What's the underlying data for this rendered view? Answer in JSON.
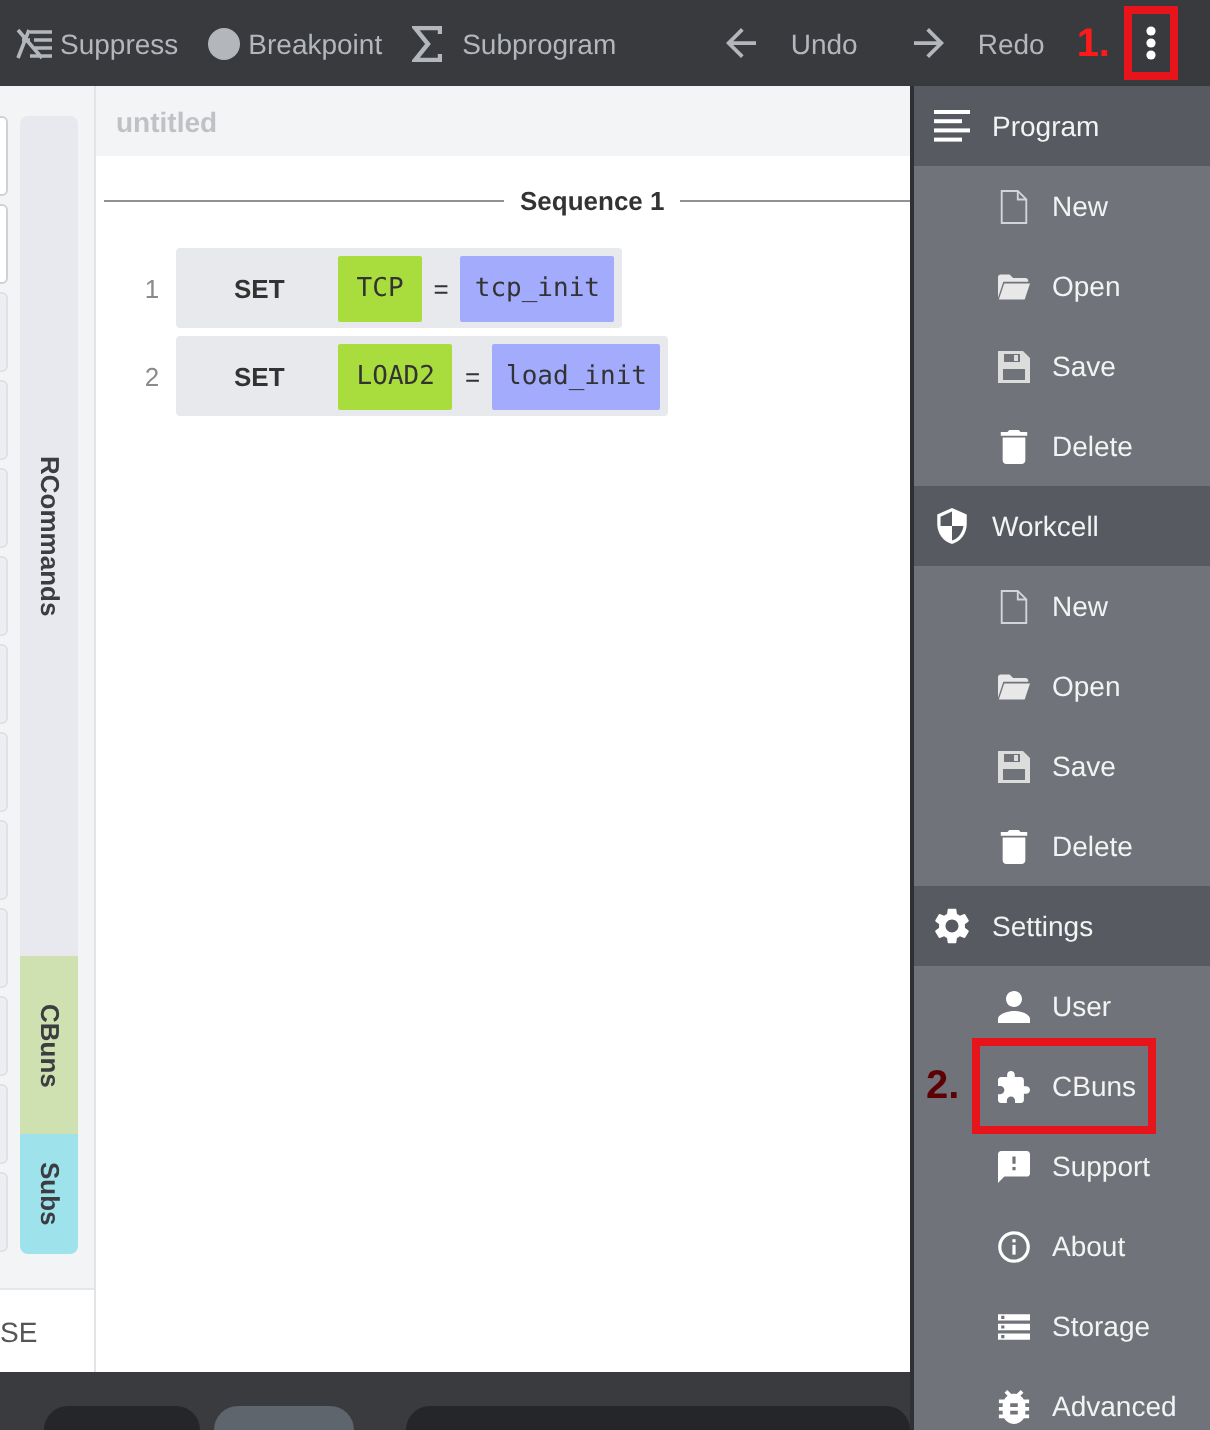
{
  "toolbar": {
    "tools": [
      {
        "kind": "suppress",
        "label": "Suppress"
      },
      {
        "kind": "breakpoint",
        "label": "Breakpoint"
      },
      {
        "kind": "subprogram",
        "label": "Subprogram"
      }
    ],
    "history": [
      {
        "kind": "undo",
        "label": "Undo"
      },
      {
        "kind": "redo",
        "label": "Redo"
      }
    ],
    "more_button": {
      "annotation": "1."
    }
  },
  "left_panel": {
    "side_tabs": [
      {
        "label": "RCommands",
        "color": "#e8e9ee"
      },
      {
        "label": "CBuns",
        "color": "#cfe0b1"
      },
      {
        "label": "Subs",
        "color": "#9ee3ec"
      }
    ],
    "footer_text": "SE"
  },
  "document": {
    "title": "untitled",
    "sequence_title": "Sequence 1",
    "lines": [
      {
        "number": "1",
        "command": "SET",
        "target": "TCP",
        "operator": "=",
        "value": "tcp_init"
      },
      {
        "number": "2",
        "command": "SET",
        "target": "LOAD2",
        "operator": "=",
        "value": "load_init"
      }
    ]
  },
  "menu": {
    "sections": [
      {
        "title": "Program",
        "kind": "lines",
        "items": [
          {
            "label": "New",
            "kind": "file"
          },
          {
            "label": "Open",
            "kind": "folder"
          },
          {
            "label": "Save",
            "kind": "floppy"
          },
          {
            "label": "Delete",
            "kind": "trash"
          }
        ]
      },
      {
        "title": "Workcell",
        "kind": "shield",
        "items": [
          {
            "label": "New",
            "kind": "file"
          },
          {
            "label": "Open",
            "kind": "folder"
          },
          {
            "label": "Save",
            "kind": "floppy"
          },
          {
            "label": "Delete",
            "kind": "trash"
          }
        ]
      },
      {
        "title": "Settings",
        "kind": "gear",
        "items": [
          {
            "label": "User",
            "kind": "person"
          },
          {
            "label": "CBuns",
            "kind": "puzzle",
            "annotation": "2."
          },
          {
            "label": "Support",
            "kind": "feedback"
          },
          {
            "label": "About",
            "kind": "info"
          },
          {
            "label": "Storage",
            "kind": "storage"
          },
          {
            "label": "Advanced",
            "kind": "bug"
          }
        ]
      }
    ]
  }
}
